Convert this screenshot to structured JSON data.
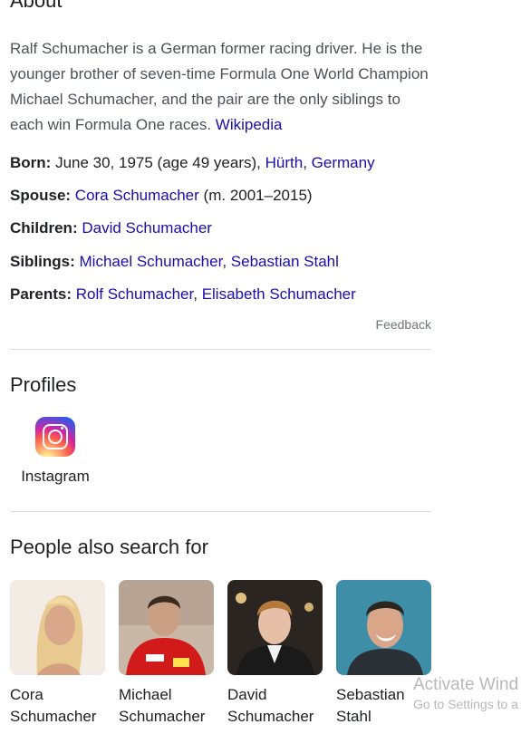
{
  "about": {
    "title": "About",
    "description": "Ralf Schumacher is a German former racing driver. He is the younger brother of seven-time Formula One World Champion Michael Schumacher, and the pair are the only siblings to each win Formula One races.",
    "source_link": "Wikipedia"
  },
  "facts": {
    "born_label": "Born:",
    "born_text": "June 30, 1975 (age 49 years),",
    "born_link1": "Hürth",
    "born_sep": ",",
    "born_link2": "Germany",
    "spouse_label": "Spouse:",
    "spouse_link": "Cora Schumacher",
    "spouse_text": "(m. 2001–2015)",
    "children_label": "Children:",
    "children_link": "David Schumacher",
    "siblings_label": "Siblings:",
    "siblings_link1": "Michael Schumacher",
    "siblings_sep": ",",
    "siblings_link2": "Sebastian Stahl",
    "parents_label": "Parents:",
    "parents_link1": "Rolf Schumacher",
    "parents_sep": ",",
    "parents_link2": "Elisabeth Schumacher"
  },
  "feedback": "Feedback",
  "profiles": {
    "title": "Profiles",
    "items": [
      {
        "label": "Instagram",
        "icon": "instagram-icon"
      }
    ]
  },
  "people_also_search": {
    "title": "People also search for",
    "items": [
      {
        "line1": "Cora",
        "line2": "Schumacher"
      },
      {
        "line1": "Michael",
        "line2": "Schumacher"
      },
      {
        "line1": "David",
        "line2": "Schumacher"
      },
      {
        "line1": "Sebastian",
        "line2": "Stahl"
      }
    ]
  },
  "watermark": {
    "line1": "Activate Wind",
    "line2": "Go to Settings to a"
  },
  "colors": {
    "link": "#1a0dab",
    "text": "#202124",
    "muted": "#70757a",
    "divider": "#dadce0"
  }
}
